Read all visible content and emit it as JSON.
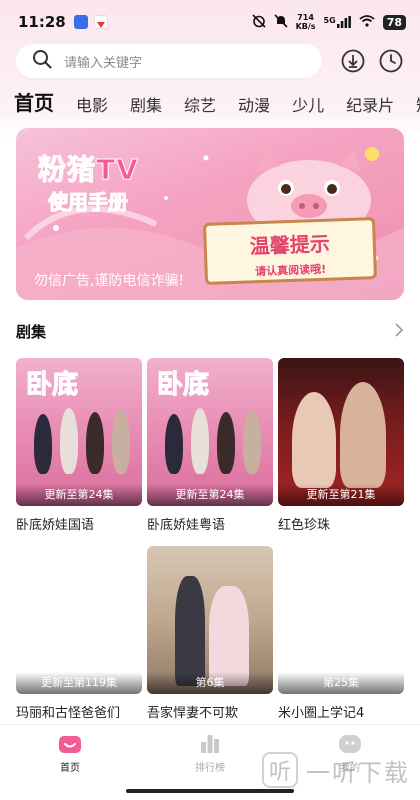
{
  "status_bar": {
    "time": "11:28",
    "net_speed_value": "714",
    "net_speed_unit": "KB/s",
    "network": "5G",
    "battery": "78"
  },
  "search": {
    "placeholder": "请输入关键字"
  },
  "tabs": [
    {
      "label": "首页",
      "active": true
    },
    {
      "label": "电影"
    },
    {
      "label": "剧集"
    },
    {
      "label": "综艺"
    },
    {
      "label": "动漫"
    },
    {
      "label": "少儿"
    },
    {
      "label": "纪录片"
    },
    {
      "label": "短"
    }
  ],
  "banner": {
    "title": "粉猪TV",
    "subtitle": "使用手册",
    "notice_title": "温馨提示",
    "notice_sub": "请认真阅读哦!",
    "warning": "勿信广告,谨防电信诈骗!"
  },
  "section": {
    "title": "剧集",
    "more_icon": "chevron-right-icon"
  },
  "cards": [
    {
      "title": "卧底娇娃国语",
      "caption": "更新至第24集",
      "poster": "pink"
    },
    {
      "title": "卧底娇娃粤语",
      "caption": "更新至第24集",
      "poster": "pink"
    },
    {
      "title": "红色珍珠",
      "caption": "更新至第21集",
      "poster": "red"
    },
    {
      "title": "玛丽和古怪爸爸们",
      "caption": "更新至第119集",
      "poster": "empty"
    },
    {
      "title": "吾家悍妻不可欺",
      "caption": "第6集",
      "poster": "cream"
    },
    {
      "title": "米小圈上学记4",
      "caption": "第25集",
      "poster": "empty"
    }
  ],
  "bottom_nav": [
    {
      "label": "首页",
      "icon": "home-icon",
      "active": true
    },
    {
      "label": "排行榜",
      "icon": "ranking-icon"
    },
    {
      "label": "我的",
      "icon": "profile-icon"
    }
  ],
  "watermark": {
    "badge": "听",
    "text": "一听下载"
  },
  "colors": {
    "accent": "#f35c93",
    "background": "#fbe6ee"
  }
}
